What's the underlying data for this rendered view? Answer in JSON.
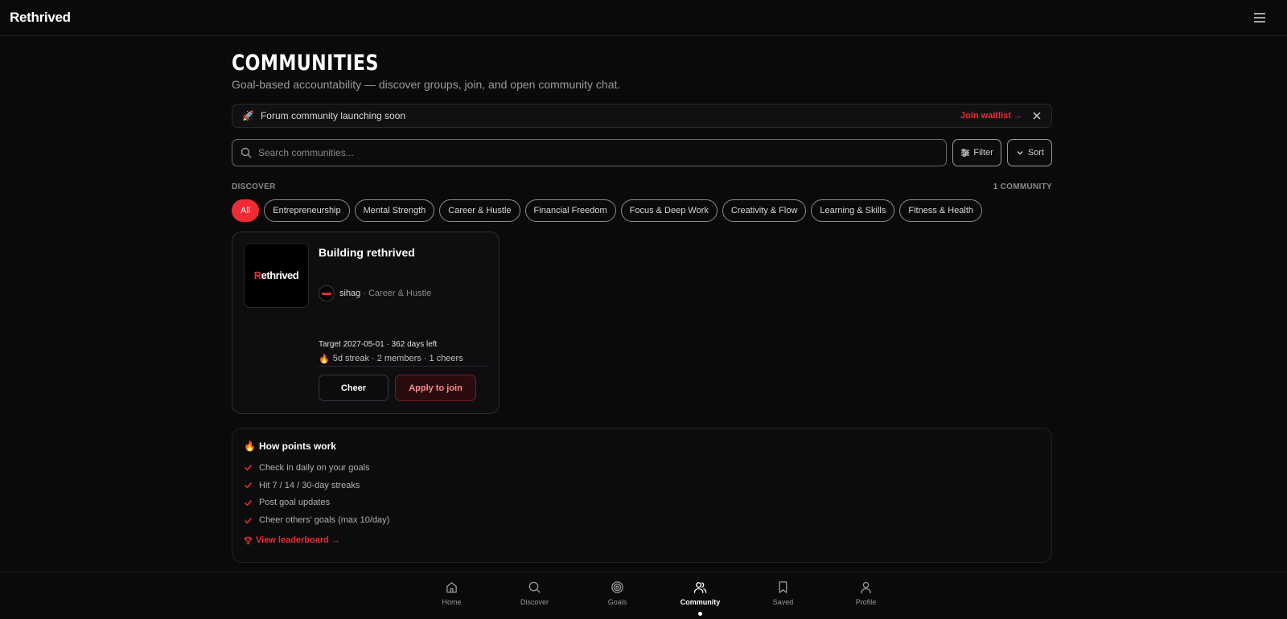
{
  "app": {
    "brand": "Rethrived"
  },
  "header": {
    "title": "COMMUNITIES",
    "subtitle": "Goal-based accountability — discover groups, join, and open community chat."
  },
  "banner": {
    "icon": "🚀",
    "text": "Forum community launching soon",
    "action": "Join waitlist →"
  },
  "search": {
    "placeholder": "Search communities...",
    "value": "",
    "filter_label": "Filter",
    "sort_label": "Sort"
  },
  "discover": {
    "label": "DISCOVER",
    "count": "1 COMMUNITY",
    "chips": [
      {
        "label": "All",
        "active": true
      },
      {
        "label": "Entrepreneurship",
        "active": false
      },
      {
        "label": "Mental Strength",
        "active": false
      },
      {
        "label": "Career & Hustle",
        "active": false
      },
      {
        "label": "Financial Freedom",
        "active": false
      },
      {
        "label": "Focus & Deep Work",
        "active": false
      },
      {
        "label": "Creativity & Flow",
        "active": false
      },
      {
        "label": "Learning & Skills",
        "active": false
      },
      {
        "label": "Fitness & Health",
        "active": false
      }
    ]
  },
  "community": {
    "logo_text_r": "R",
    "logo_text_rest": "ethrived",
    "title": "Building rethrived",
    "owner": "sihag",
    "separator": "·",
    "category": "Career & Hustle",
    "target": "Target 2027-05-01 · 362 days left",
    "streak_icon": "🔥",
    "stats": "5d streak · 2 members · 1 cheers",
    "cheer_label": "Cheer",
    "apply_label": "Apply to join"
  },
  "points": {
    "icon": "🔥",
    "title": "How points work",
    "items": [
      "Check in daily on your goals",
      "Hit 7 / 14 / 30-day streaks",
      "Post goal updates",
      "Cheer others' goals (max 10/day)"
    ],
    "leaderboard": "View leaderboard →"
  },
  "nav": {
    "items": [
      {
        "label": "Home",
        "icon": "home-icon",
        "active": false
      },
      {
        "label": "Discover",
        "icon": "search-icon",
        "active": false
      },
      {
        "label": "Goals",
        "icon": "target-icon",
        "active": false
      },
      {
        "label": "Community",
        "icon": "users-icon",
        "active": true
      },
      {
        "label": "Saved",
        "icon": "bookmark-icon",
        "active": false
      },
      {
        "label": "Profile",
        "icon": "user-icon",
        "active": false
      }
    ]
  },
  "colors": {
    "accent": "#ef2b36",
    "background": "#0a0a0b"
  }
}
